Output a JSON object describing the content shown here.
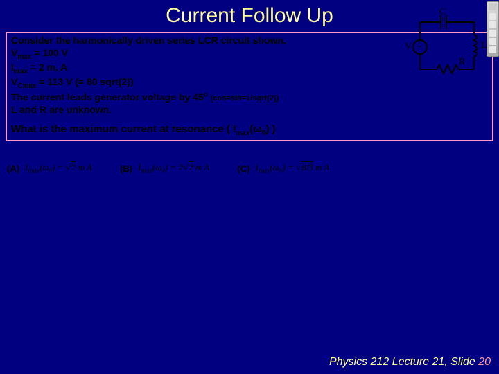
{
  "title": "Current Follow Up",
  "problem": {
    "line1": "Consider the harmonically driven series LCR circuit shown.",
    "vmax_label": "V",
    "vmax_sub": "max",
    "vmax_rest": " = 100 V",
    "imax_label": "I",
    "imax_sub": "max",
    "imax_rest": " = 2 m. A",
    "vcmax_label": "V",
    "vcmax_sub": "Cmax",
    "vcmax_rest": " = 113 V (= 80 sqrt(2))",
    "line5a": "The current leads generator voltage by 45",
    "line5deg": "o",
    "line5b": " (cos=sin=1/sqrt(2))",
    "line6": "L and R are unknown."
  },
  "question": {
    "pre": "What is the maximum current at resonance (  I",
    "sub": "max",
    "mid": "(ω",
    "sub2": "0",
    "post": ")  )"
  },
  "choices": {
    "a_label": "(A)",
    "a_math_pre": "I",
    "a_math_sub": "max",
    "a_math_arg": "(ω₀) = ",
    "a_root": "2",
    "a_unit": " m A",
    "b_label": "(B)",
    "b_math_pre": "I",
    "b_math_sub": "max",
    "b_math_arg": "(ω₀) = 2",
    "b_root": "2",
    "b_unit": " m A",
    "c_label": "(C)",
    "c_math_pre": "I",
    "c_math_sub": "max",
    "c_math_arg": "(ω₀) = ",
    "c_root": "8/3",
    "c_unit": " m A"
  },
  "diagram": {
    "C": "C",
    "V": "V",
    "L": "L",
    "R": "R",
    "tilde": "~"
  },
  "footer": {
    "course": "Physics 212",
    "lecture": "  Lecture 21, Slide ",
    "slide": "20"
  }
}
